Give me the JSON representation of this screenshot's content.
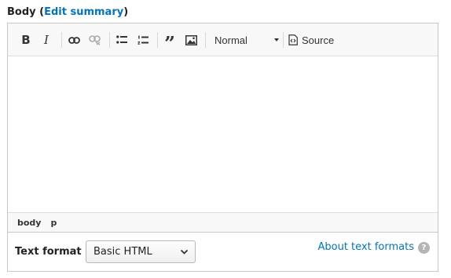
{
  "field": {
    "label": "Body",
    "open_paren": " (",
    "summary_link": "Edit summary",
    "close_paren": ")"
  },
  "toolbar": {
    "buttons": [
      {
        "name": "bold",
        "glyph": "B"
      },
      {
        "name": "italic",
        "glyph": "I"
      },
      {
        "name": "link",
        "icon": "link-icon"
      },
      {
        "name": "unlink",
        "icon": "unlink-icon"
      },
      {
        "name": "bulleted-list",
        "icon": "bulleted-list-icon"
      },
      {
        "name": "numbered-list",
        "icon": "numbered-list-icon"
      },
      {
        "name": "blockquote",
        "glyph": "”"
      },
      {
        "name": "image",
        "icon": "image-icon"
      }
    ],
    "format_value": "Normal",
    "source_label": "Source"
  },
  "pathbar": {
    "items": [
      "body",
      "p"
    ]
  },
  "text_format": {
    "label": "Text format",
    "selected": "Basic HTML",
    "about_link": "About text formats",
    "help_glyph": "?"
  },
  "colors": {
    "link": "#0074bd",
    "toolbar_bg": "#f8f8f8",
    "border": "#c8c8c8"
  }
}
